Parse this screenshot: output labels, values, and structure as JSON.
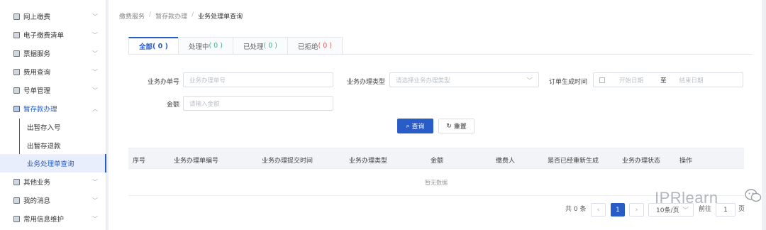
{
  "sidebar": {
    "items": [
      {
        "label": "网上缴费",
        "icon": "card-icon"
      },
      {
        "label": "电子缴费清单",
        "icon": "list-icon"
      },
      {
        "label": "票据服务",
        "icon": "receipt-icon"
      },
      {
        "label": "费用查询",
        "icon": "search-fee-icon"
      },
      {
        "label": "号单管理",
        "icon": "document-icon"
      },
      {
        "label": "暂存款办理",
        "icon": "deposit-icon"
      },
      {
        "label": "其他业务",
        "icon": "other-icon"
      },
      {
        "label": "我的消息",
        "icon": "message-icon"
      },
      {
        "label": "常用信息维护",
        "icon": "info-icon"
      }
    ],
    "subitems": [
      {
        "label": "出暂存入号"
      },
      {
        "label": "出暂存退款"
      },
      {
        "label": "业务处理单查询"
      }
    ]
  },
  "breadcrumb": {
    "items": [
      "缴费服务",
      "暂存款办理",
      "业务处理单查询"
    ],
    "separator": "/"
  },
  "tabs": [
    {
      "label": "全部",
      "count": "( 0 )"
    },
    {
      "label": "处理中",
      "count": "( 0 )"
    },
    {
      "label": "已处理",
      "count": "( 0 )"
    },
    {
      "label": "已拒绝",
      "count": "( 0 )"
    }
  ],
  "form": {
    "order_no_label": "业务办单号",
    "order_no_placeholder": "业务办理单号",
    "type_label": "业务办理类型",
    "type_placeholder": "请选择业务办理类型",
    "time_label": "订单生成时间",
    "start_placeholder": "开始日期",
    "range_sep": "至",
    "end_placeholder": "结束日期",
    "amount_label": "金额",
    "amount_placeholder": "请输入金额",
    "search_button": "查询",
    "reset_button": "重置"
  },
  "table": {
    "columns": [
      "序号",
      "业务办理单编号",
      "业务办理提交时间",
      "业务办理类型",
      "金额",
      "缴费人",
      "是否已经重新生成",
      "业务办理状态",
      "操作"
    ],
    "empty_text": "暂无数据"
  },
  "pagination": {
    "total": "共 0 条",
    "current_page": "1",
    "page_size": "10条/页",
    "goto_prefix": "前往",
    "goto_value": "1",
    "goto_suffix": "页"
  },
  "watermark": "IPRlearn",
  "colors": {
    "accent": "#2a5cc7",
    "green": "#3bb08f",
    "red": "#e05b5b"
  }
}
